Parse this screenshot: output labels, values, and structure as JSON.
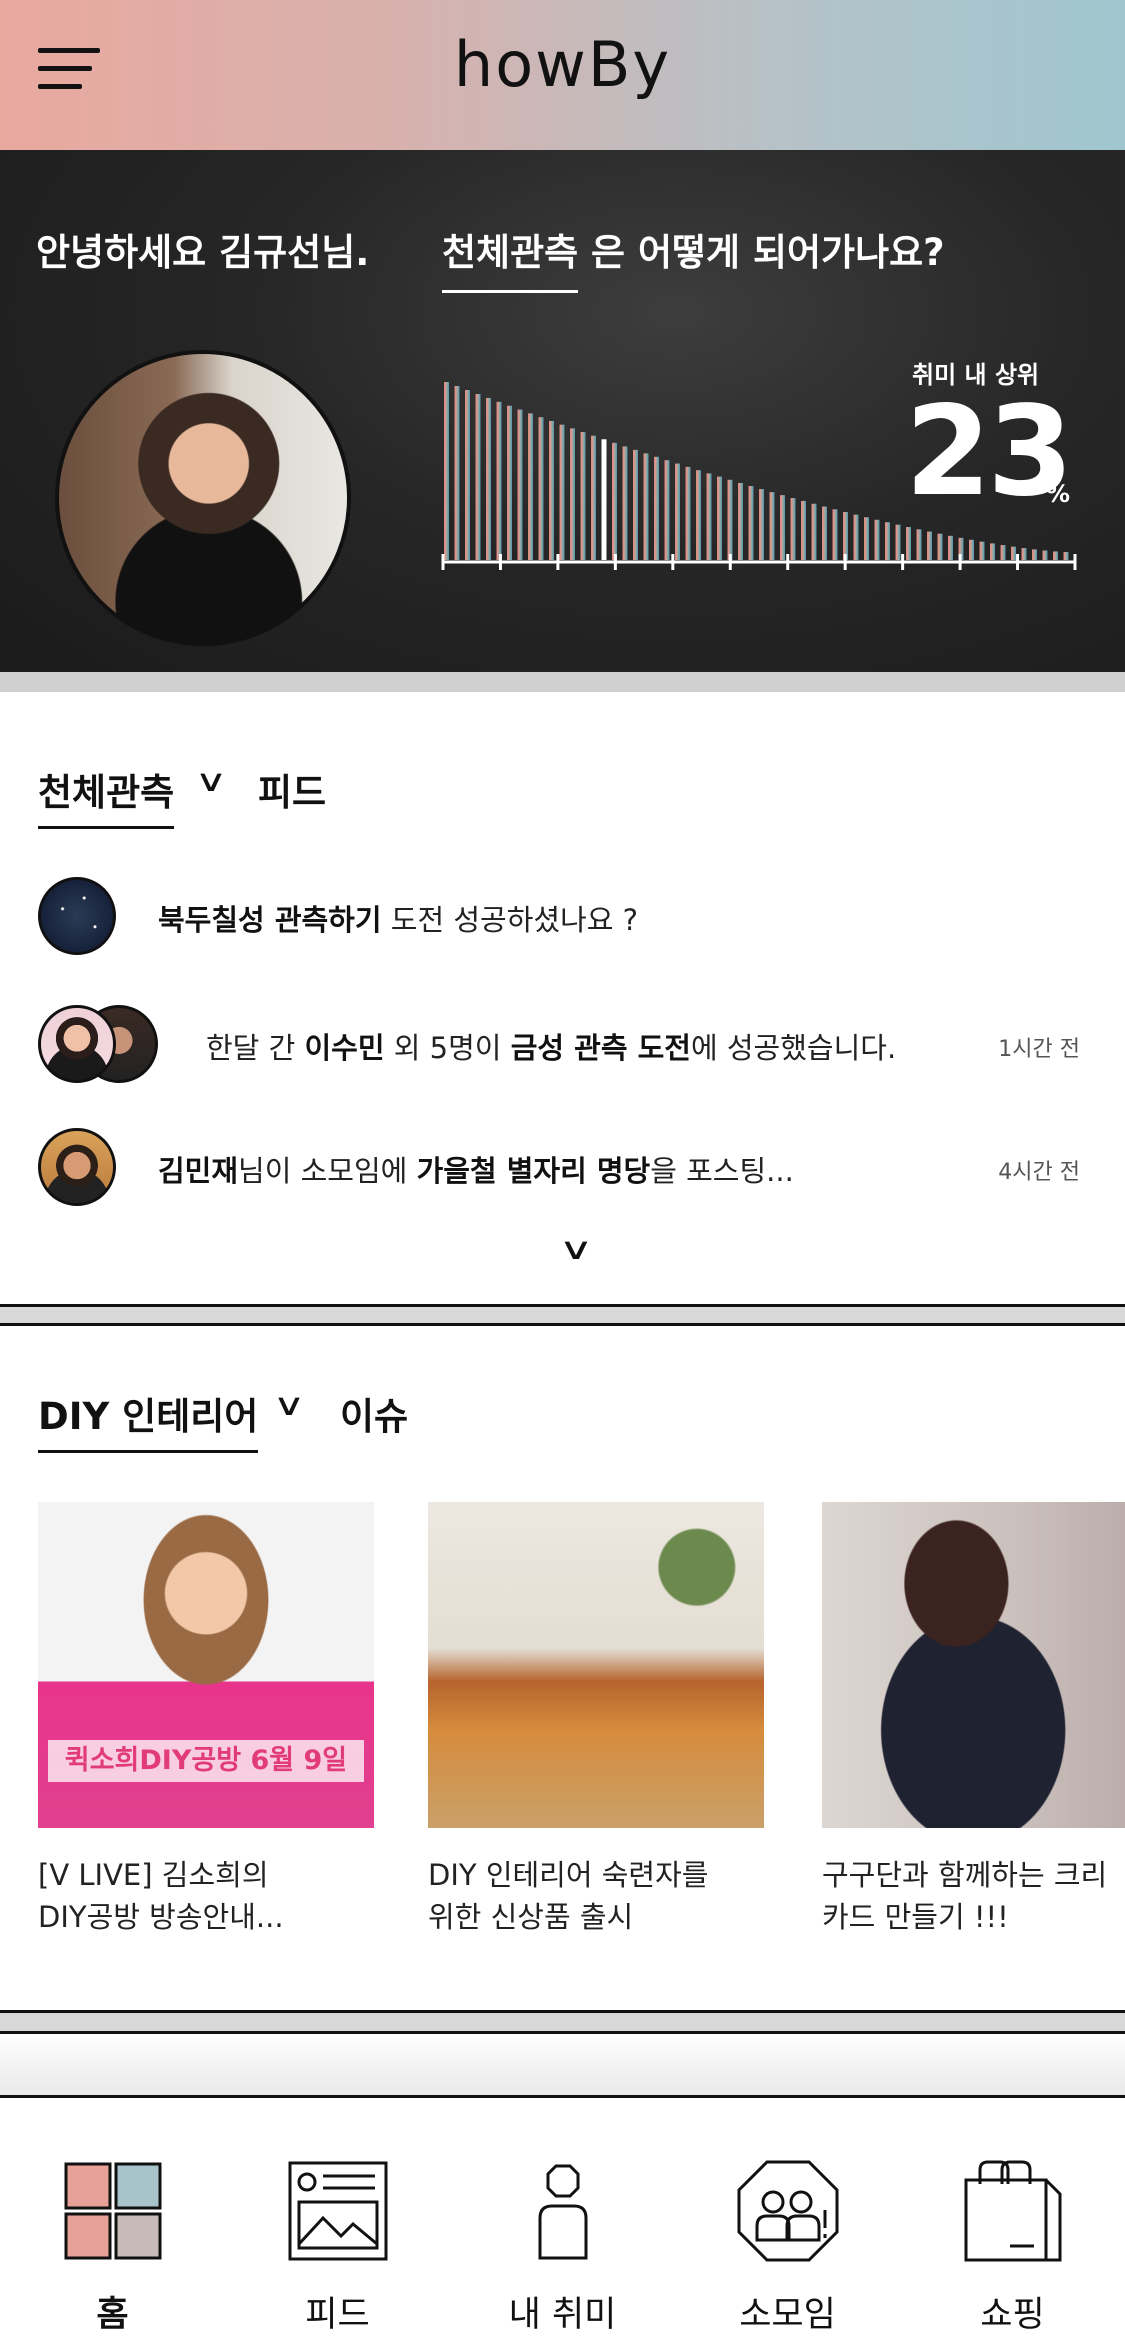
{
  "header": {
    "app_title": "howBy",
    "menu_icon": "hamburger-menu-icon"
  },
  "hero": {
    "greeting": "안녕하세요 김규선님.",
    "hobby": "천체관측",
    "question_suffix": " 은 어떻게 되어가나요?",
    "rank_label": "취미 내 상위",
    "rank_value": "23",
    "rank_unit": "%",
    "rank_percent": 23
  },
  "feed_section": {
    "hobby": "천체관측",
    "label": "피드",
    "items": [
      {
        "pre": "",
        "b1": "북두칠성 관측하기",
        "mid": " 도전 성공하셨나요 ?",
        "b2": "",
        "post": "",
        "time": ""
      },
      {
        "pre": "한달 간 ",
        "b1": "이수민",
        "mid": " 외 5명이 ",
        "b2": "금성 관측 도전",
        "post": "에 성공했습니다.",
        "time": "1시간 전"
      },
      {
        "pre": "",
        "b1": "김민재",
        "mid": "님이 소모임에  ",
        "b2": "가을철 별자리 명당",
        "post": "을 포스팅...",
        "time": "4시간 전"
      }
    ]
  },
  "issue_section": {
    "hobby": "DIY 인테리어",
    "label": "이슈",
    "cards": [
      {
        "image_text": "퀵소희DIY공방 6월 9일",
        "line1": "[V LIVE] 김소희의",
        "line2": "DIY공방 방송안내..."
      },
      {
        "image_text": "",
        "line1": "DIY 인테리어 숙련자를",
        "line2": "위한 신상품 출시"
      },
      {
        "image_text": "",
        "line1": "구구단과 함께하는 크리",
        "line2": "카드  만들기 !!!"
      }
    ]
  },
  "bottom_nav": {
    "items": [
      {
        "label": "홈",
        "icon": "home-grid-icon"
      },
      {
        "label": "피드",
        "icon": "feed-image-icon"
      },
      {
        "label": "내 취미",
        "icon": "my-hobby-person-icon"
      },
      {
        "label": "소모임",
        "icon": "group-people-icon"
      },
      {
        "label": "쇼핑",
        "icon": "shopping-bag-icon"
      }
    ]
  },
  "colors": {
    "accent_start": "#e9a99f",
    "accent_end": "#9fc6cf",
    "bar_warm": "#e0857a",
    "bar_cool": "#4f97ad"
  }
}
